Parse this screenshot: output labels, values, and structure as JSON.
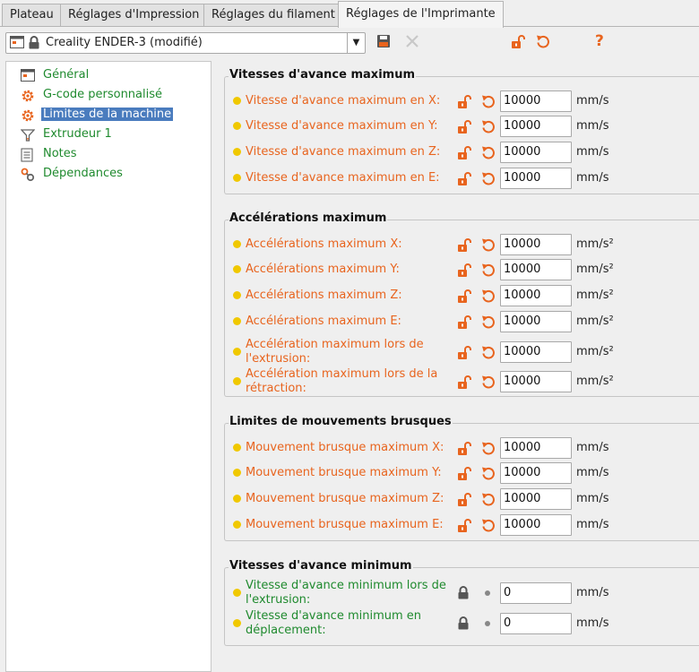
{
  "tabs": [
    "Plateau",
    "Réglages d'Impression",
    "Réglages du filament",
    "Réglages de l'Imprimante"
  ],
  "preset": {
    "name": "Creality ENDER-3 (modifié)"
  },
  "toolbar_icons": [
    "save-icon",
    "delete-icon",
    "unlock-icon",
    "undo-icon",
    "help-icon"
  ],
  "help_label": "?",
  "tree": [
    {
      "label": "Général",
      "icon": "printer-icon"
    },
    {
      "label": "G-code personnalisé",
      "icon": "cog-icon"
    },
    {
      "label": "Limites de la machine",
      "icon": "cog-icon"
    },
    {
      "label": "Extrudeur 1",
      "icon": "funnel-icon"
    },
    {
      "label": "Notes",
      "icon": "note-icon"
    },
    {
      "label": "Dépendances",
      "icon": "wrench-icon"
    }
  ],
  "groups": [
    {
      "title": "Vitesses d'avance maximum",
      "rows": [
        {
          "label": "Vitesse d'avance maximum en X:",
          "value": "10000",
          "unit": "mm/s"
        },
        {
          "label": "Vitesse d'avance maximum en Y:",
          "value": "10000",
          "unit": "mm/s"
        },
        {
          "label": "Vitesse d'avance maximum en Z:",
          "value": "10000",
          "unit": "mm/s"
        },
        {
          "label": "Vitesse d'avance maximum en E:",
          "value": "10000",
          "unit": "mm/s"
        }
      ]
    },
    {
      "title": "Accélérations maximum",
      "rows": [
        {
          "label": "Accélérations maximum X:",
          "value": "10000",
          "unit": "mm/s²"
        },
        {
          "label": "Accélérations maximum Y:",
          "value": "10000",
          "unit": "mm/s²"
        },
        {
          "label": "Accélérations maximum Z:",
          "value": "10000",
          "unit": "mm/s²"
        },
        {
          "label": "Accélérations maximum E:",
          "value": "10000",
          "unit": "mm/s²"
        },
        {
          "label1": "Accélération maximum lors de",
          "label2": "l'extrusion:",
          "value": "10000",
          "unit": "mm/s²"
        },
        {
          "label1": "Accélération maximum lors de la",
          "label2": "rétraction:",
          "value": "10000",
          "unit": "mm/s²"
        }
      ]
    },
    {
      "title": "Limites de mouvements brusques",
      "rows": [
        {
          "label": "Mouvement brusque maximum X:",
          "value": "10000",
          "unit": "mm/s"
        },
        {
          "label": "Mouvement brusque maximum Y:",
          "value": "10000",
          "unit": "mm/s"
        },
        {
          "label": "Mouvement brusque maximum Z:",
          "value": "10000",
          "unit": "mm/s"
        },
        {
          "label": "Mouvement brusque maximum E:",
          "value": "10000",
          "unit": "mm/s"
        }
      ]
    },
    {
      "title": "Vitesses d'avance minimum",
      "rows": [
        {
          "label1": "Vitesse d'avance minimum lors de",
          "label2": "l'extrusion:",
          "value": "0",
          "unit": "mm/s"
        },
        {
          "label1": "Vitesse d'avance minimum en",
          "label2": "déplacement:",
          "value": "0",
          "unit": "mm/s"
        }
      ]
    }
  ],
  "colors": {
    "modified_label": "#e8641e",
    "default_label": "#1f8a2e",
    "dot": "#f0c800",
    "selection": "#4a7cbe"
  }
}
